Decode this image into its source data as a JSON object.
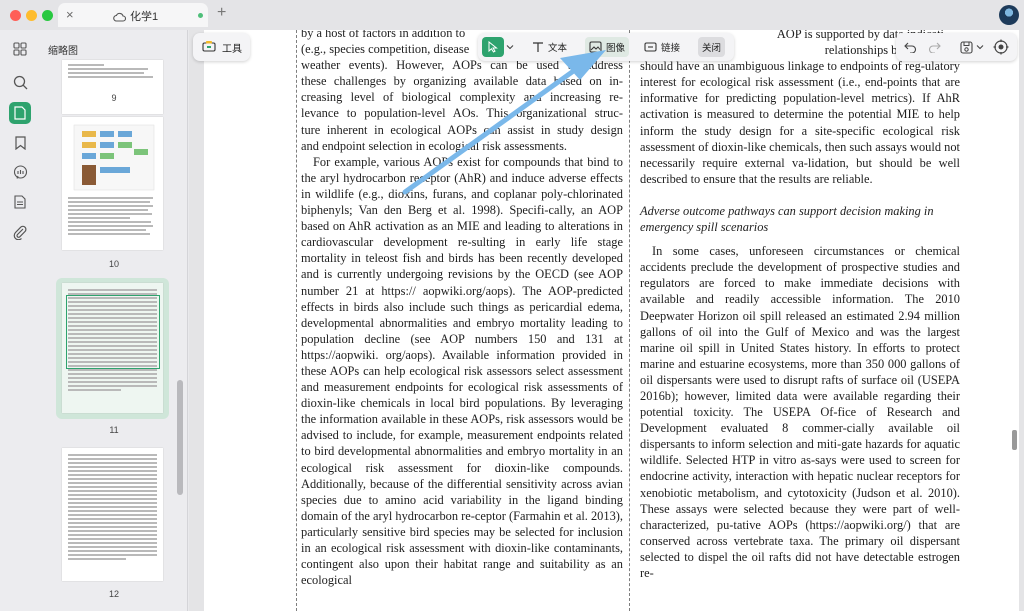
{
  "window": {
    "tab_title": "化学1",
    "tab_add": "+",
    "tab_close": "×"
  },
  "rail": {
    "items": [
      {
        "name": "grid-icon"
      },
      {
        "name": "search-icon"
      },
      {
        "name": "page-icon"
      },
      {
        "name": "bookmark-icon"
      },
      {
        "name": "comment-icon"
      },
      {
        "name": "attachment-page-icon"
      },
      {
        "name": "paperclip-icon"
      }
    ],
    "active_color": "#2ea36e"
  },
  "thumbnails": {
    "title": "缩略图",
    "pages": [
      {
        "number": "9"
      },
      {
        "number": "10"
      },
      {
        "number": "11",
        "active": true
      },
      {
        "number": "12"
      }
    ]
  },
  "toolbar": {
    "tools_label": "工具",
    "text_label": "文本",
    "image_label": "图像",
    "link_label": "链接",
    "close_label": "关闭"
  },
  "document": {
    "col1_lines": [
      "by a host of factors in addition to",
      "(e.g., species competition, disease",
      "weather events). However, AOPs can be used to address",
      "these challenges by organizing available data based on in-",
      "creasing level of biological complexity and increasing re-",
      "levance to population-level AOs. This organizational struc-",
      "ture inherent in ecological AOPs can assist in study design",
      "and endpoint selection in ecological risk assessments."
    ],
    "col1_paragraph": "For example, various AOPs exist for compounds that bind to the aryl hydrocarbon receptor (AhR) and induce adverse effects in wildlife (e.g., dioxins, furans, and coplanar poly-chlorinated biphenyls; Van den Berg et al. 1998). Specifi-cally, an AOP based on AhR activation as an MIE and leading to alterations in cardiovascular development re-sulting in early life stage mortality in teleost fish and birds has been recently developed and is currently undergoing revisions by the OECD (see AOP number 21 at https:// aopwiki.org/aops). The AOP-predicted effects in birds also include such things as pericardial edema, developmental abnormalities and embryo mortality leading to population decline (see AOP numbers 150 and 131 at https://aopwiki. org/aops). Available information provided in these AOPs can help ecological risk assessors select assessment and measurement endpoints for ecological risk assessments of dioxin-like chemicals in local bird populations. By leveraging the information available in these AOPs, risk assessors would be advised to include, for example, measurement endpoints related to bird developmental abnormalities and embryo mortality in an ecological risk assessment for dioxin-like compounds. Additionally, because of the differential sensitivity across avian species due to amino acid variability in the ligand binding domain of the aryl hydrocarbon re-ceptor (Farmahin et al. 2013), particularly sensitive bird species may be selected for inclusion in an ecological risk assessment with dioxin-like contaminants, contingent also upon their habitat range and suitability as an ecological",
    "col2_lines": [
      "AOP is supported by data indicati",
      "relationships between KEs."
    ],
    "col2_paragraph1": "should have an unambiguous linkage to endpoints of reg-ulatory interest for ecological risk assessment (i.e., end-points that are informative for predicting population-level metrics). If AhR activation is measured to determine the potential MIE to help inform the study design for a site-specific ecological risk assessment of dioxin-like chemicals, then such assays would not necessarily require external va-lidation, but should be well described to ensure that the results are reliable.",
    "col2_heading": "Adverse outcome pathways can support decision making in emergency spill scenarios",
    "col2_paragraph2": "In some cases, unforeseen circumstances or chemical accidents preclude the development of prospective studies and regulators are forced to make immediate decisions with available and readily accessible information. The 2010 Deepwater Horizon oil spill released an estimated 2.94 million gallons of oil into the Gulf of Mexico and was the largest marine oil spill in United States history. In efforts to protect marine and estuarine ecosystems, more than 350 000 gallons of oil dispersants were used to disrupt rafts of surface oil (USEPA 2016b); however, limited data were available regarding their potential toxicity. The USEPA Of-fice of Research and Development evaluated 8 commer-cially available oil dispersants to inform selection and miti-gate hazards for aquatic wildlife. Selected HTP in vitro as-says were used to screen for endocrine activity, interaction with hepatic nuclear receptors for xenobiotic metabolism, and cytotoxicity (Judson et al. 2010). These assays were selected because they were part of well-characterized, pu-tative AOPs (https://aopwiki.org/) that are conserved across vertebrate taxa. The primary oil dispersant selected to dispel the oil rafts did not have detectable estrogen re-"
  },
  "colors": {
    "accent": "#2ea36e",
    "annotation_arrow": "#7ab8ea"
  }
}
